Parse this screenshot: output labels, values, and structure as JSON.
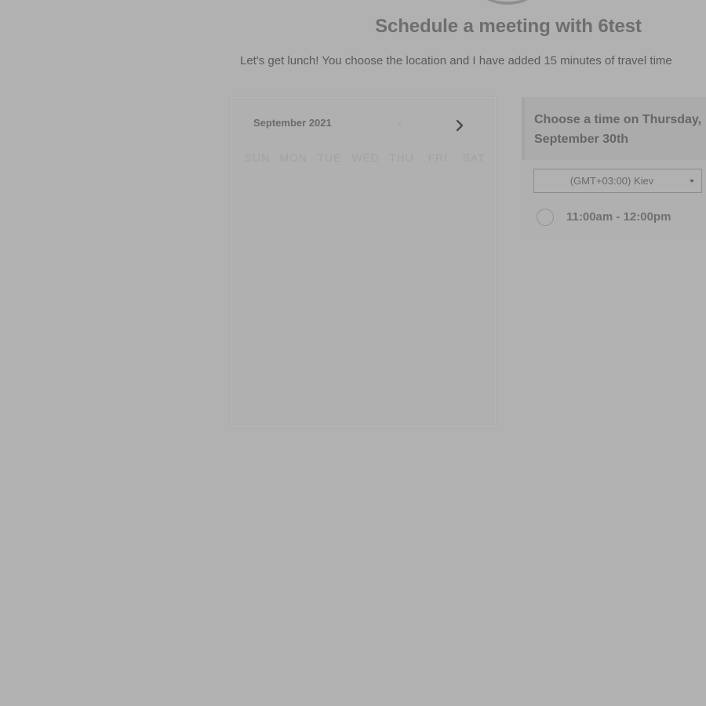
{
  "page": {
    "title": "Schedule a meeting with 6test",
    "subtitle": "Let's get lunch! You choose the location and I have added 15 minutes of travel time"
  },
  "calendar": {
    "month_label": "September 2021",
    "prev_icon": "chevron-left-icon",
    "next_icon": "chevron-right-icon",
    "weekdays": [
      "SUN",
      "MON",
      "TUE",
      "WED",
      "THU",
      "FRI",
      "SAT"
    ]
  },
  "time_picker": {
    "heading": "Choose a time on Thursday, September 30th",
    "timezone": "(GMT+03:00) Kiev",
    "slots": [
      {
        "label": "11:00am - 12:00pm",
        "selected": false
      }
    ]
  }
}
